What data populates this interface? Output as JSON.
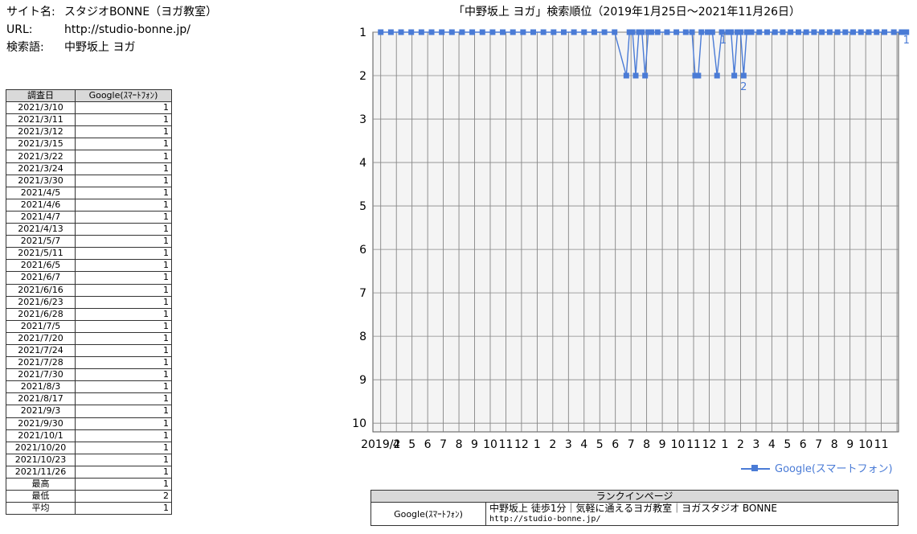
{
  "site_info": {
    "name_label": "サイト名:",
    "name_value": "スタジオBONNE（ヨガ教室）",
    "url_label": "URL:",
    "url_value": "http://studio-bonne.jp/",
    "keyword_label": "検索語:",
    "keyword_value": "中野坂上 ヨガ"
  },
  "rank_table": {
    "headers": [
      "調査日",
      "Google(ｽﾏｰﾄﾌｫﾝ)"
    ],
    "rows": [
      [
        "2021/3/10",
        "1"
      ],
      [
        "2021/3/11",
        "1"
      ],
      [
        "2021/3/12",
        "1"
      ],
      [
        "2021/3/15",
        "1"
      ],
      [
        "2021/3/22",
        "1"
      ],
      [
        "2021/3/24",
        "1"
      ],
      [
        "2021/3/30",
        "1"
      ],
      [
        "2021/4/5",
        "1"
      ],
      [
        "2021/4/6",
        "1"
      ],
      [
        "2021/4/7",
        "1"
      ],
      [
        "2021/4/13",
        "1"
      ],
      [
        "2021/5/7",
        "1"
      ],
      [
        "2021/5/11",
        "1"
      ],
      [
        "2021/6/5",
        "1"
      ],
      [
        "2021/6/7",
        "1"
      ],
      [
        "2021/6/16",
        "1"
      ],
      [
        "2021/6/23",
        "1"
      ],
      [
        "2021/6/28",
        "1"
      ],
      [
        "2021/7/5",
        "1"
      ],
      [
        "2021/7/20",
        "1"
      ],
      [
        "2021/7/24",
        "1"
      ],
      [
        "2021/7/28",
        "1"
      ],
      [
        "2021/7/30",
        "1"
      ],
      [
        "2021/8/3",
        "1"
      ],
      [
        "2021/8/17",
        "1"
      ],
      [
        "2021/9/3",
        "1"
      ],
      [
        "2021/9/30",
        "1"
      ],
      [
        "2021/10/1",
        "1"
      ],
      [
        "2021/10/20",
        "1"
      ],
      [
        "2021/10/23",
        "1"
      ],
      [
        "2021/11/26",
        "1"
      ]
    ],
    "summary": [
      [
        "最高",
        "1"
      ],
      [
        "最低",
        "2"
      ],
      [
        "平均",
        "1"
      ]
    ]
  },
  "chart_data": {
    "type": "line",
    "title": "「中野坂上 ヨガ」検索順位（2019年1月25日～2021年11月26日）",
    "x_ticks": [
      "2019/2",
      "4",
      "5",
      "6",
      "7",
      "8",
      "9",
      "10",
      "11",
      "12",
      "1",
      "2",
      "3",
      "4",
      "5",
      "6",
      "7",
      "8",
      "9",
      "10",
      "11",
      "12",
      "1",
      "2",
      "3",
      "4",
      "5",
      "6",
      "7",
      "8",
      "9",
      "10",
      "11"
    ],
    "y_ticks": [
      "1",
      "2",
      "3",
      "4",
      "5",
      "6",
      "7",
      "8",
      "9",
      "10"
    ],
    "ylim": [
      1,
      10
    ],
    "y_inverted": true,
    "grid": true,
    "legend_position": "bottom-right",
    "color": "#4a7bd6",
    "series": [
      {
        "name": "Google(スマートフォン)",
        "points": [
          [
            0,
            1
          ],
          [
            0.65,
            1
          ],
          [
            1.3,
            1
          ],
          [
            1.95,
            1
          ],
          [
            2.6,
            1
          ],
          [
            3.25,
            1
          ],
          [
            3.9,
            1
          ],
          [
            4.55,
            1
          ],
          [
            5.2,
            1
          ],
          [
            5.85,
            1
          ],
          [
            6.5,
            1
          ],
          [
            7.15,
            1
          ],
          [
            7.8,
            1
          ],
          [
            8.45,
            1
          ],
          [
            9.1,
            1
          ],
          [
            9.75,
            1
          ],
          [
            10.4,
            1
          ],
          [
            11.05,
            1
          ],
          [
            11.7,
            1
          ],
          [
            12.35,
            1
          ],
          [
            13,
            1
          ],
          [
            13.65,
            1
          ],
          [
            14.3,
            1
          ],
          [
            14.95,
            1
          ],
          [
            15.7,
            2
          ],
          [
            15.9,
            1
          ],
          [
            16.1,
            1
          ],
          [
            16.3,
            2
          ],
          [
            16.5,
            1
          ],
          [
            16.7,
            1
          ],
          [
            16.9,
            2
          ],
          [
            17.1,
            1
          ],
          [
            17.3,
            1
          ],
          [
            17.7,
            1
          ],
          [
            18.3,
            1
          ],
          [
            18.9,
            1
          ],
          [
            19.5,
            1
          ],
          [
            19.9,
            1
          ],
          [
            20.1,
            2
          ],
          [
            20.3,
            2
          ],
          [
            20.5,
            1
          ],
          [
            20.9,
            1
          ],
          [
            21.2,
            1
          ],
          [
            21.5,
            2
          ],
          [
            21.8,
            1
          ],
          [
            22.2,
            1
          ],
          [
            22.4,
            1
          ],
          [
            22.6,
            2
          ],
          [
            22.8,
            1
          ],
          [
            23,
            1
          ],
          [
            23.2,
            2
          ],
          [
            23.4,
            1
          ],
          [
            23.7,
            1
          ],
          [
            24.2,
            1
          ],
          [
            24.7,
            1
          ],
          [
            25.2,
            1
          ],
          [
            25.7,
            1
          ],
          [
            26.2,
            1
          ],
          [
            26.7,
            1
          ],
          [
            27.2,
            1
          ],
          [
            27.7,
            1
          ],
          [
            28.2,
            1
          ],
          [
            28.7,
            1
          ],
          [
            29.2,
            1
          ],
          [
            29.7,
            1
          ],
          [
            30.2,
            1
          ],
          [
            30.7,
            1
          ],
          [
            31.2,
            1
          ],
          [
            31.7,
            1
          ],
          [
            32.2,
            1
          ],
          [
            32.8,
            1
          ],
          [
            33.3,
            1
          ],
          [
            33.6,
            1
          ]
        ]
      }
    ],
    "annotations": [
      {
        "x": 21.9,
        "y": 1,
        "text": "1"
      },
      {
        "x": 23.2,
        "y": 2,
        "text": "2"
      },
      {
        "x": 33.6,
        "y": 1,
        "text": "1"
      }
    ]
  },
  "legend": {
    "label": "Google(スマートフォン)"
  },
  "landing_table": {
    "header": "ランクインページ",
    "engine": "Google(ｽﾏｰﾄﾌｫﾝ)",
    "page_title": "中野坂上 徒歩1分｜気軽に通えるヨガ教室｜ヨガスタジオ BONNE",
    "page_url": "http://studio-bonne.jp/"
  }
}
